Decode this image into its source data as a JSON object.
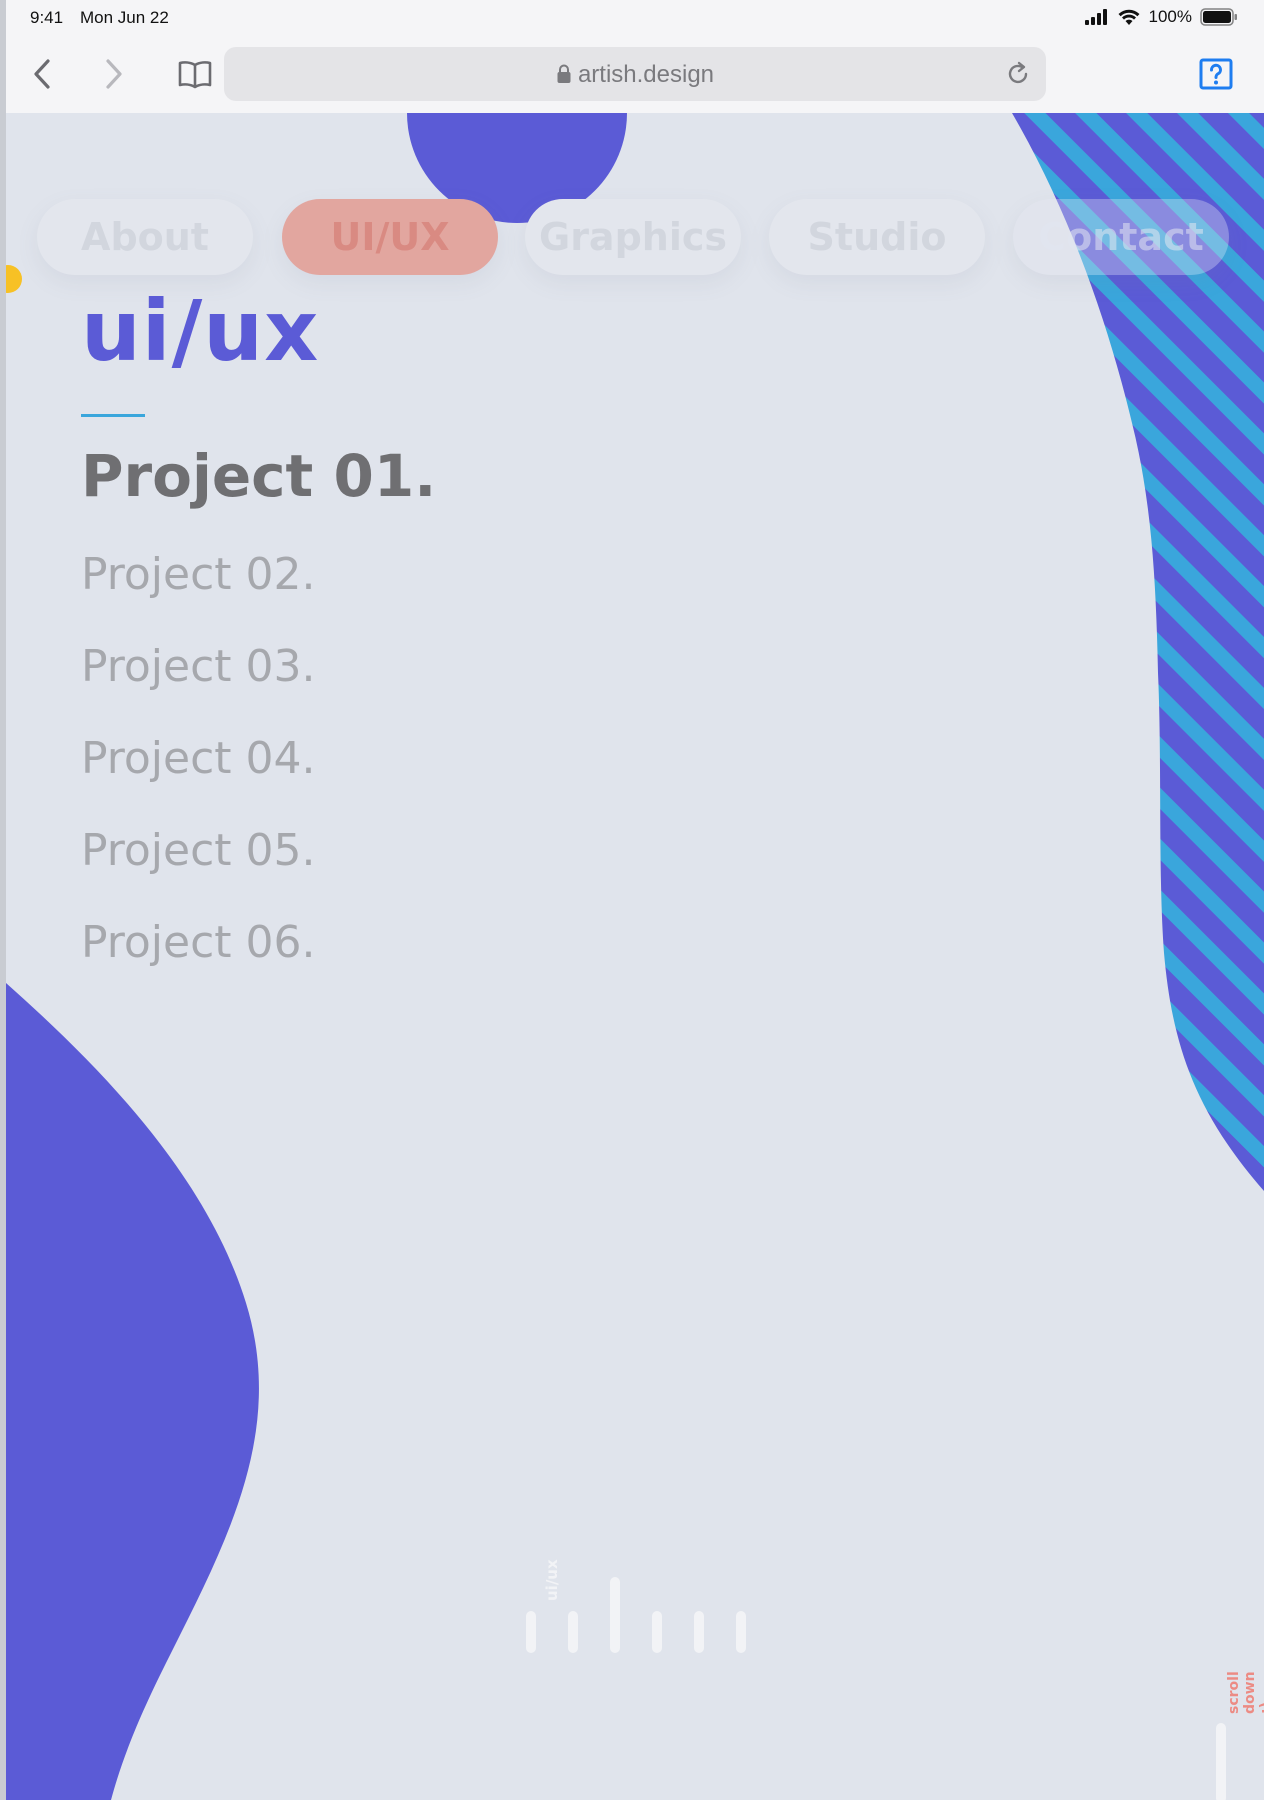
{
  "status_bar": {
    "time": "9:41",
    "date": "Mon Jun 22",
    "battery": "100%",
    "icons": [
      "signal-icon",
      "wifi-icon",
      "battery-icon"
    ]
  },
  "browser": {
    "url": "artish.design",
    "icons": [
      "back-icon",
      "forward-icon",
      "bookmarks-icon",
      "lock-icon",
      "reload-icon",
      "help-icon"
    ]
  },
  "nav": {
    "items": [
      {
        "label": "About",
        "active": false
      },
      {
        "label": "UI/UX",
        "active": true
      },
      {
        "label": "Graphics",
        "active": false
      },
      {
        "label": "Studio",
        "active": false
      },
      {
        "label": "Contact",
        "active": false
      }
    ]
  },
  "section": {
    "title": "ui/ux",
    "projects": [
      "Project 01.",
      "Project 02.",
      "Project 03.",
      "Project 04.",
      "Project 05.",
      "Project 06."
    ],
    "active_project": 0
  },
  "indicator": {
    "label": "ui/ux",
    "ticks": 6,
    "active_tick": 2
  },
  "scroll_hint": "scroll down :)",
  "colors": {
    "background": "#e0e4ec",
    "brand_purple": "#5b5bd6",
    "accent_blue": "#3aa6dc",
    "nav_active": "#e2a69f",
    "hint_red": "#ec8b84",
    "dot_yellow": "#f7c125"
  }
}
